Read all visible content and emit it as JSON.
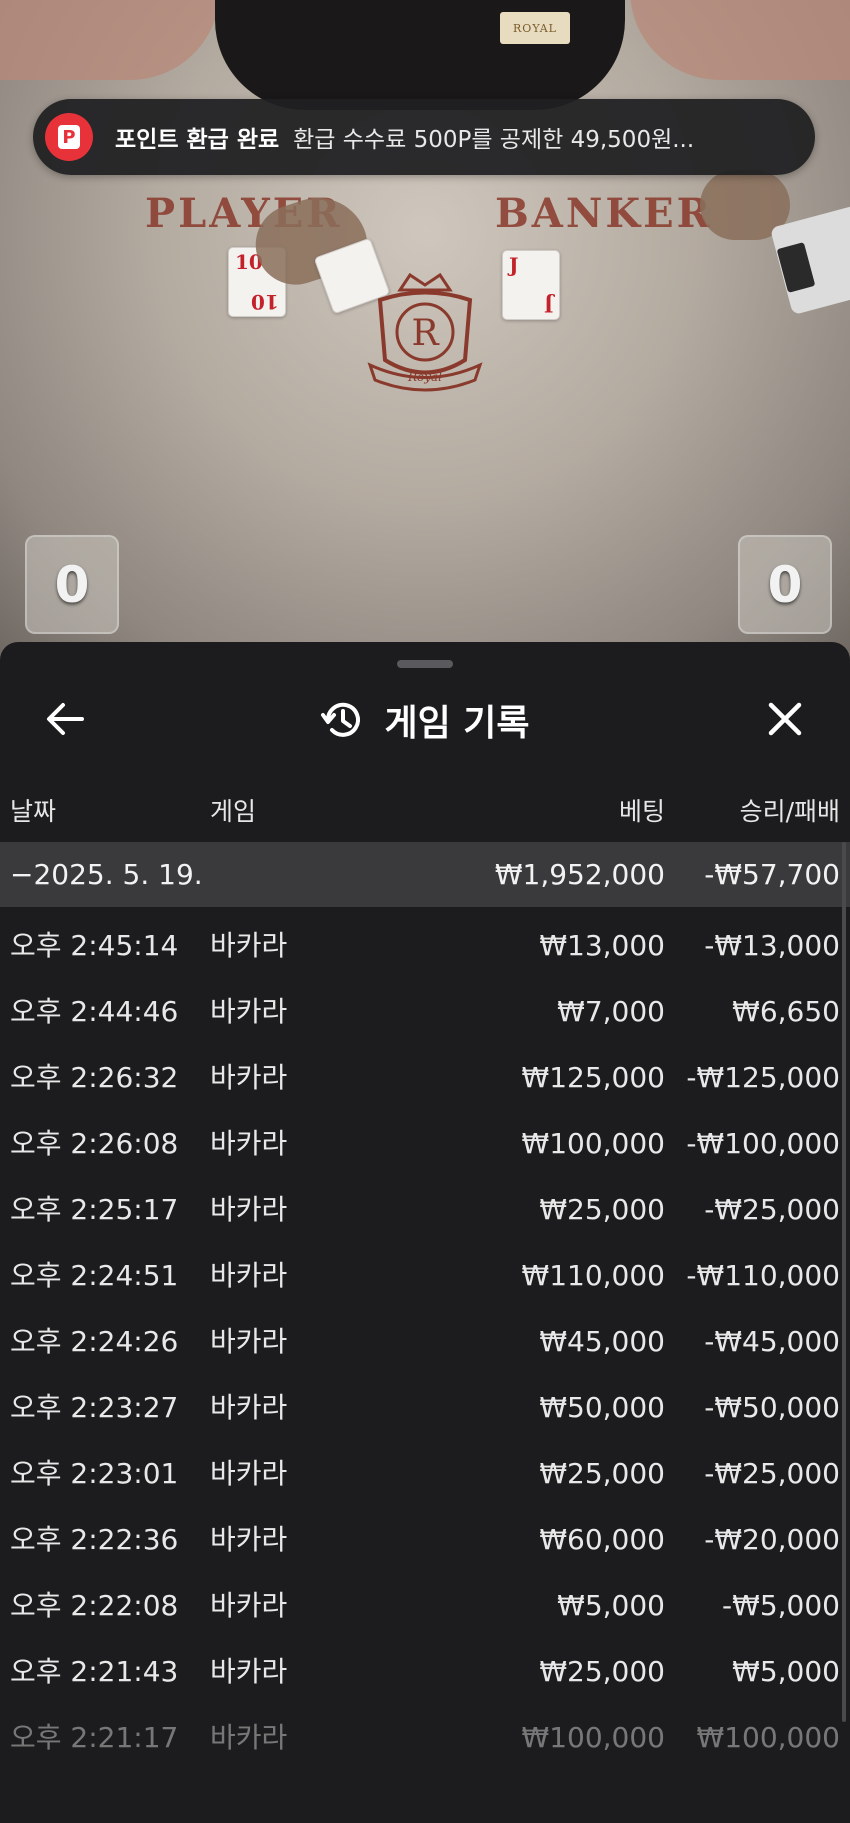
{
  "table": {
    "player_label": "PLAYER",
    "banker_label": "BANKER",
    "brand_badge": "ROYAL",
    "emblem_letter": "R",
    "emblem_text": "Royal",
    "player_score": "0",
    "banker_score": "0",
    "cards": {
      "player_1_rank": "10",
      "banker_1_rank": "J"
    }
  },
  "toast": {
    "icon_letter": "P",
    "title": "포인트 환급 완료",
    "message": "환급 수수료 500P를 공제한 49,500원..."
  },
  "sheet": {
    "title": "게임 기록",
    "columns": {
      "date": "날짜",
      "game": "게임",
      "bet": "베팅",
      "result": "승리/패배"
    },
    "summary": {
      "date": "−2025. 5. 19.",
      "bet": "₩1,952,000",
      "result": "-₩57,700"
    },
    "rows": [
      {
        "time": "오후 2:45:14",
        "game": "바카라",
        "bet": "₩13,000",
        "result": "-₩13,000"
      },
      {
        "time": "오후 2:44:46",
        "game": "바카라",
        "bet": "₩7,000",
        "result": "₩6,650"
      },
      {
        "time": "오후 2:26:32",
        "game": "바카라",
        "bet": "₩125,000",
        "result": "-₩125,000"
      },
      {
        "time": "오후 2:26:08",
        "game": "바카라",
        "bet": "₩100,000",
        "result": "-₩100,000"
      },
      {
        "time": "오후 2:25:17",
        "game": "바카라",
        "bet": "₩25,000",
        "result": "-₩25,000"
      },
      {
        "time": "오후 2:24:51",
        "game": "바카라",
        "bet": "₩110,000",
        "result": "-₩110,000"
      },
      {
        "time": "오후 2:24:26",
        "game": "바카라",
        "bet": "₩45,000",
        "result": "-₩45,000"
      },
      {
        "time": "오후 2:23:27",
        "game": "바카라",
        "bet": "₩50,000",
        "result": "-₩50,000"
      },
      {
        "time": "오후 2:23:01",
        "game": "바카라",
        "bet": "₩25,000",
        "result": "-₩25,000"
      },
      {
        "time": "오후 2:22:36",
        "game": "바카라",
        "bet": "₩60,000",
        "result": "-₩20,000"
      },
      {
        "time": "오후 2:22:08",
        "game": "바카라",
        "bet": "₩5,000",
        "result": "-₩5,000"
      },
      {
        "time": "오후 2:21:43",
        "game": "바카라",
        "bet": "₩25,000",
        "result": "₩5,000"
      },
      {
        "time": "오후 2:21:17",
        "game": "바카라",
        "bet": "₩100,000",
        "result": "₩100,000"
      }
    ]
  },
  "colors": {
    "sheet_bg": "#1c1b1d",
    "summary_bg": "#3a3a3c",
    "toast_icon": "#e8323a",
    "table_text": "#8a3a2c"
  },
  "icons": {
    "back": "arrow-left-icon",
    "history": "history-icon",
    "close": "close-icon",
    "point": "point-p-icon"
  }
}
